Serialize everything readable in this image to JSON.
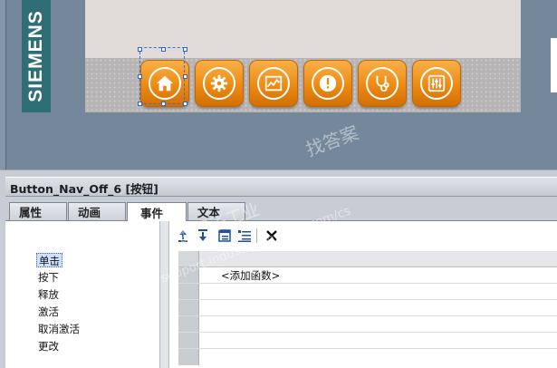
{
  "canvas": {
    "brand": "SIEMENS",
    "nav_buttons": [
      {
        "icon": "home-icon"
      },
      {
        "icon": "gear-icon"
      },
      {
        "icon": "trend-chart-icon"
      },
      {
        "icon": "alarm-warning-icon"
      },
      {
        "icon": "stethoscope-icon"
      },
      {
        "icon": "sliders-icon"
      }
    ],
    "selected_button_index": 0
  },
  "inspector": {
    "title": "Button_Nav_Off_6 [按钮]",
    "tabs": [
      {
        "label": "属性",
        "active": false
      },
      {
        "label": "动画",
        "active": false
      },
      {
        "label": "事件",
        "active": true
      },
      {
        "label": "文本",
        "active": false
      }
    ],
    "events": [
      "单击",
      "按下",
      "释放",
      "激活",
      "取消激活",
      "更改"
    ],
    "selected_event_index": 0,
    "toolbar": [
      {
        "icon": "move-up-icon"
      },
      {
        "icon": "move-down-icon"
      },
      {
        "icon": "expand-all-icon"
      },
      {
        "icon": "collapse-all-icon"
      },
      {
        "icon": "delete-x-icon"
      }
    ],
    "function_list": {
      "add_function_placeholder": "<添加函数>"
    }
  },
  "watermark": {
    "line1": "找答案",
    "line2": "support.industry.siemens.com/cs",
    "line3": "西门子工业"
  },
  "colors": {
    "button_orange": "#ee8a12",
    "brand_teal": "#2f6e74",
    "selection_blue": "#3b6fd1"
  }
}
